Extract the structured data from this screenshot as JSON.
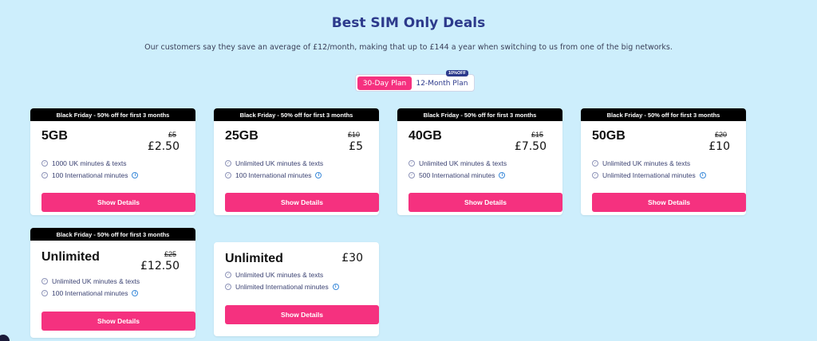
{
  "header": {
    "title": "Best SIM Only Deals",
    "subtitle": "Our customers say they save an average of £12/month, making that up to £144 a year when switching to us from one of the big networks."
  },
  "plan_toggle": {
    "options": [
      "30-Day Plan",
      "12-Month Plan"
    ],
    "selected": "30-Day Plan",
    "badge": "10%OFF"
  },
  "cards": [
    {
      "banner": "Black Friday - 50% off for first 3 months",
      "data": "5GB",
      "old_price": "£5",
      "price": "£2.50",
      "features": [
        "1000 UK minutes & texts",
        "100 International minutes"
      ],
      "button": "Show Details"
    },
    {
      "banner": "Black Friday - 50% off for first 3 months",
      "data": "25GB",
      "old_price": "£10",
      "price": "£5",
      "features": [
        "Unlimited UK minutes & texts",
        "100 International minutes"
      ],
      "button": "Show Details"
    },
    {
      "banner": "Black Friday - 50% off for first 3 months",
      "data": "40GB",
      "old_price": "£15",
      "price": "£7.50",
      "features": [
        "Unlimited UK minutes & texts",
        "500 International minutes"
      ],
      "button": "Show Details"
    },
    {
      "banner": "Black Friday - 50% off for first 3 months",
      "data": "50GB",
      "old_price": "£20",
      "price": "£10",
      "features": [
        "Unlimited UK minutes & texts",
        "Unlimited International minutes"
      ],
      "button": "Show Details"
    },
    {
      "banner": "Black Friday - 50% off for first 3 months",
      "data": "Unlimited",
      "old_price": "£25",
      "price": "£12.50",
      "features": [
        "Unlimited UK minutes & texts",
        "100 International minutes"
      ],
      "button": "Show Details"
    },
    {
      "banner": "",
      "data": "Unlimited",
      "old_price": "",
      "price": "£30",
      "features": [
        "Unlimited UK minutes & texts",
        "Unlimited International minutes"
      ],
      "button": "Show Details"
    }
  ],
  "colors": {
    "background": "#cdeefc",
    "accent": "#f5317f",
    "heading": "#2d3a8c",
    "banner": "#000000"
  }
}
